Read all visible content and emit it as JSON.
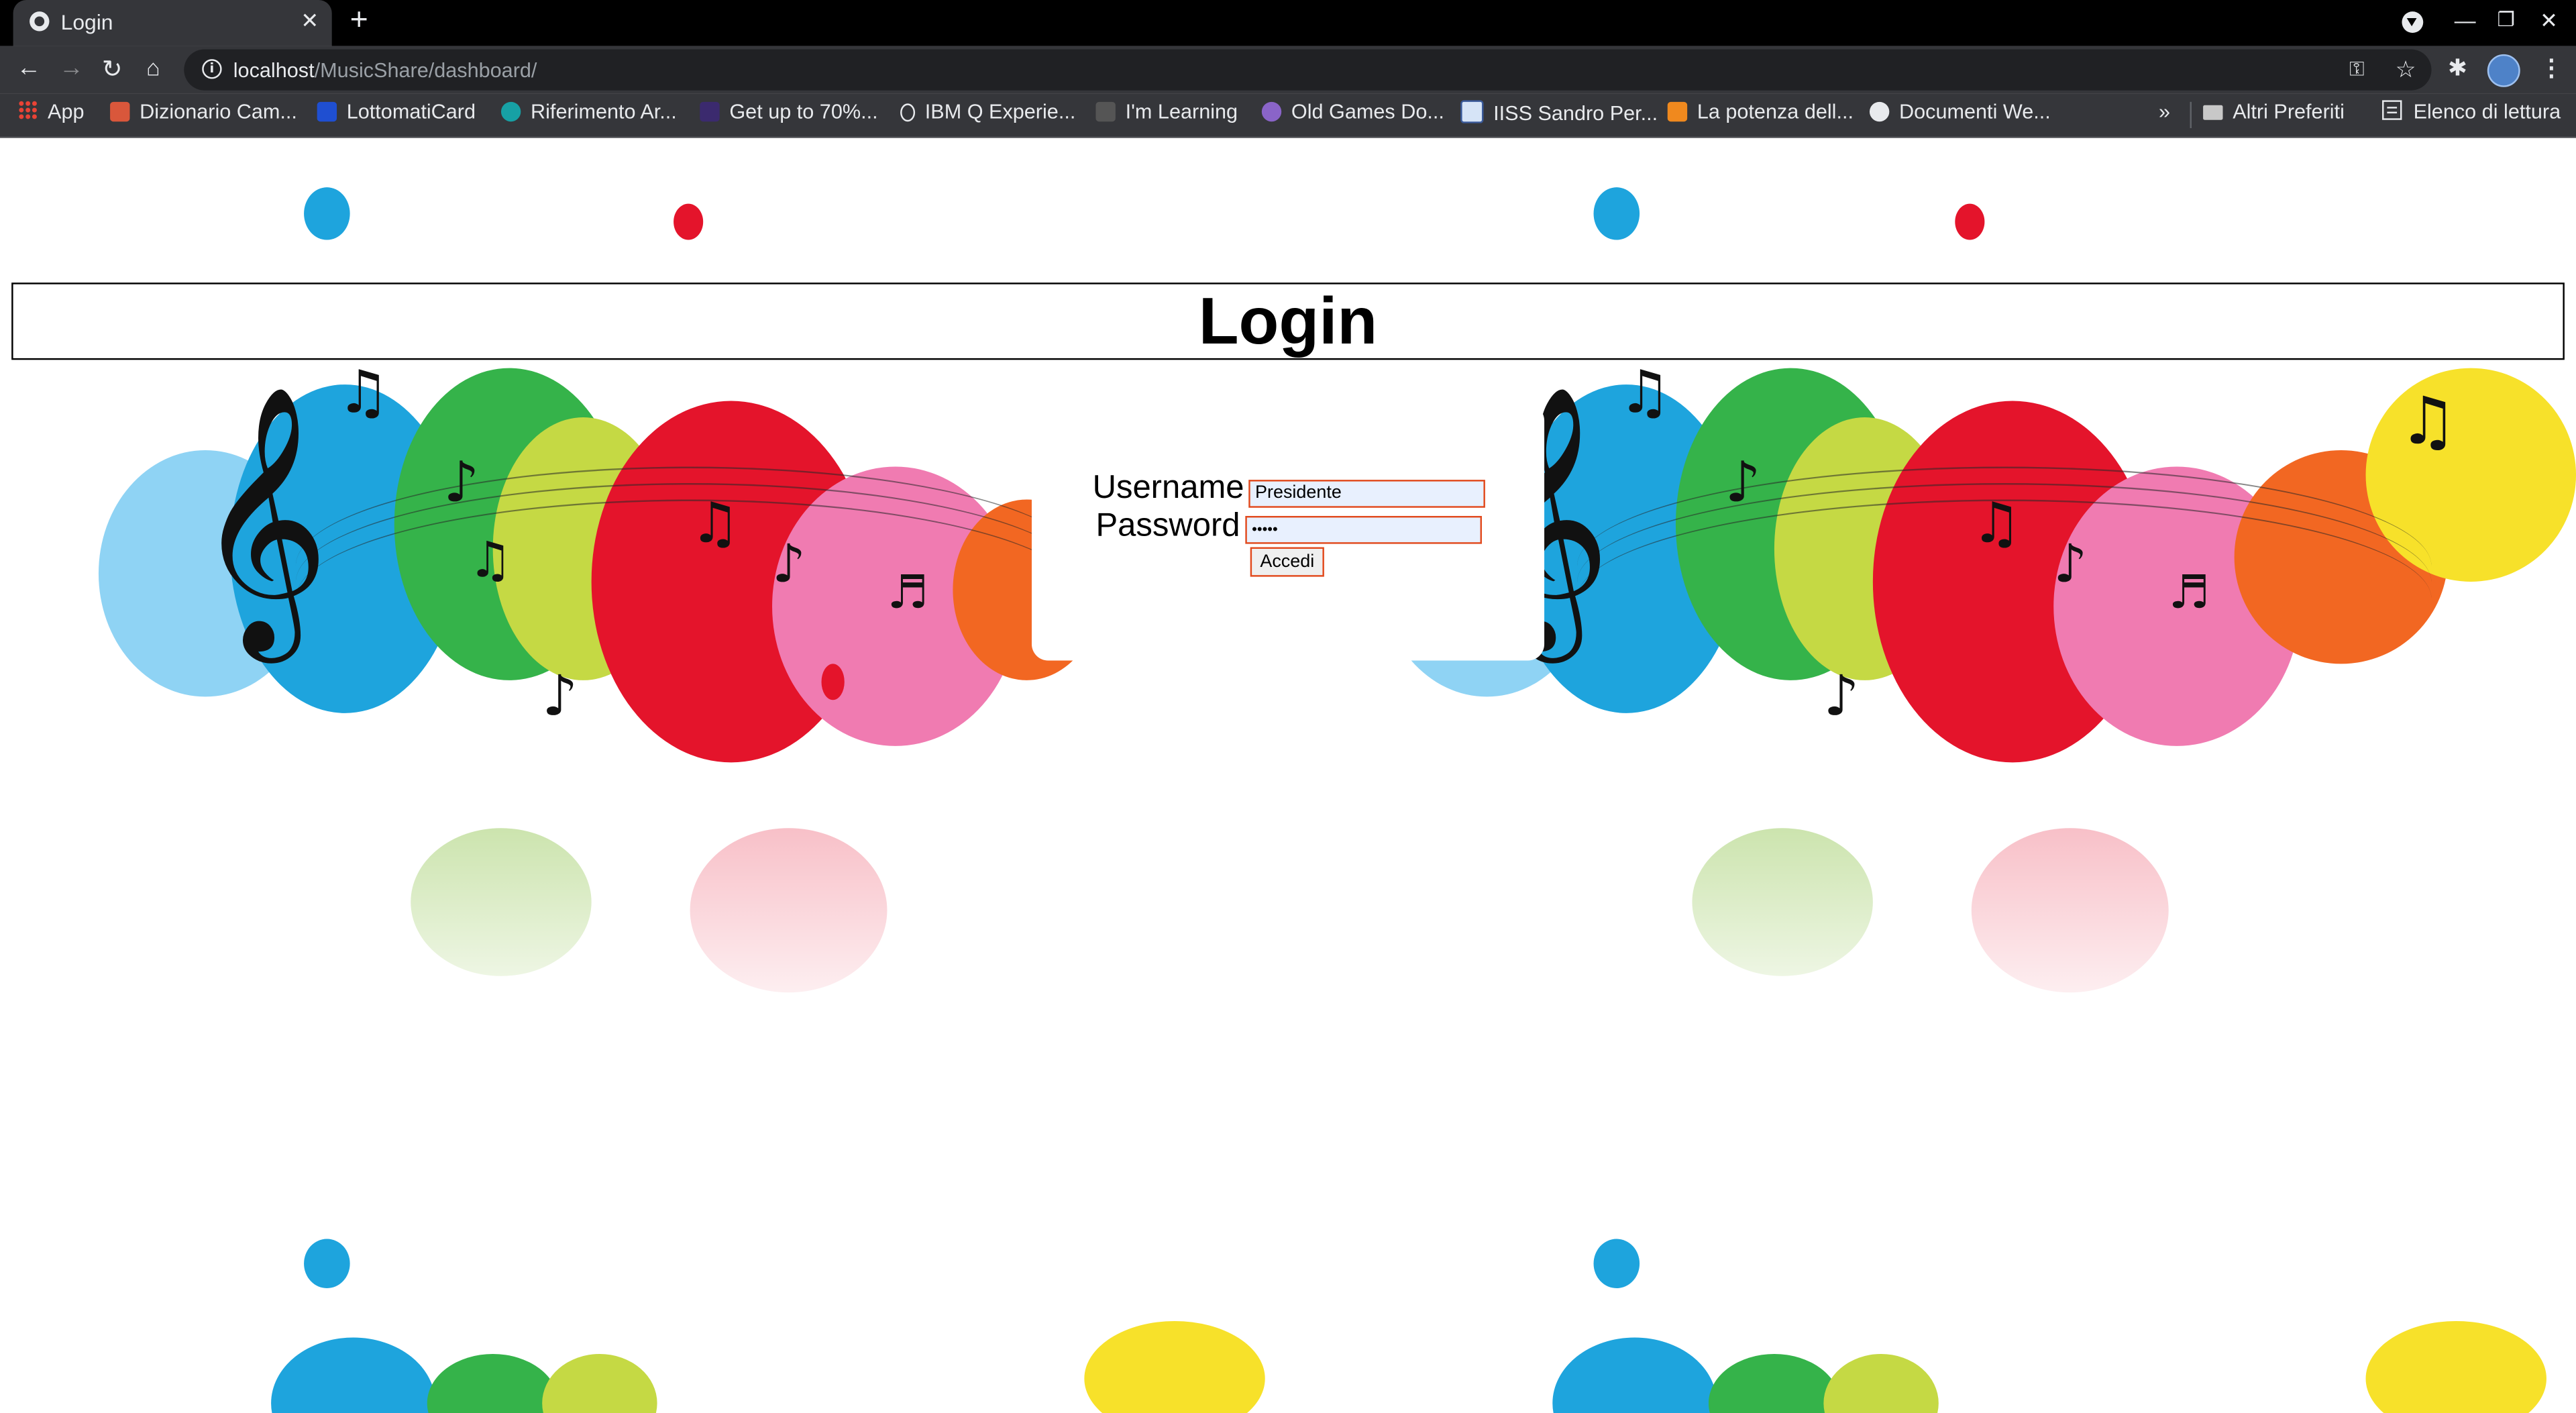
{
  "browser": {
    "tab_title": "Login",
    "url_host": "localhost",
    "url_path": "/MusicShare/dashboard/",
    "bookmarks": [
      {
        "label": "App",
        "icon": "apps-grid-icon"
      },
      {
        "label": "Dizionario Cam...",
        "icon": "dictionary-favicon",
        "color": "#d9573b"
      },
      {
        "label": "LottomatiCard",
        "icon": "lottomatica-favicon",
        "color": "#1f4fd1"
      },
      {
        "label": "Riferimento Ar...",
        "icon": "arduino-favicon",
        "color": "#17a1a5"
      },
      {
        "label": "Get up to 70%...",
        "icon": "cdk-favicon",
        "color": "#3b2a6e"
      },
      {
        "label": "IBM Q Experie...",
        "icon": "ibm-q-favicon",
        "color": "#e8eaed"
      },
      {
        "label": "I'm Learning",
        "icon": "learning-favicon",
        "color": "#555555"
      },
      {
        "label": "Old Games Do...",
        "icon": "old-games-favicon",
        "color": "#8a64c8"
      },
      {
        "label": "IISS Sandro Per...",
        "icon": "school-favicon",
        "color": "#d6e4f7"
      },
      {
        "label": "La potenza dell...",
        "icon": "amazon-favicon",
        "color": "#f0891e"
      },
      {
        "label": "Documenti We...",
        "icon": "docs-favicon",
        "color": "#e8eaed"
      }
    ],
    "overflow_label": "»",
    "other_bookmarks_label": "Altri Preferiti",
    "reading_list_label": "Elenco di lettura"
  },
  "page": {
    "title": "Login",
    "form": {
      "username_label": "Username",
      "username_value": "Presidente",
      "password_label": "Password",
      "password_value": "•••••",
      "submit_label": "Accedi"
    }
  },
  "colors": {
    "input_border": "#e24a1d",
    "input_background": "#e8f0fe"
  }
}
